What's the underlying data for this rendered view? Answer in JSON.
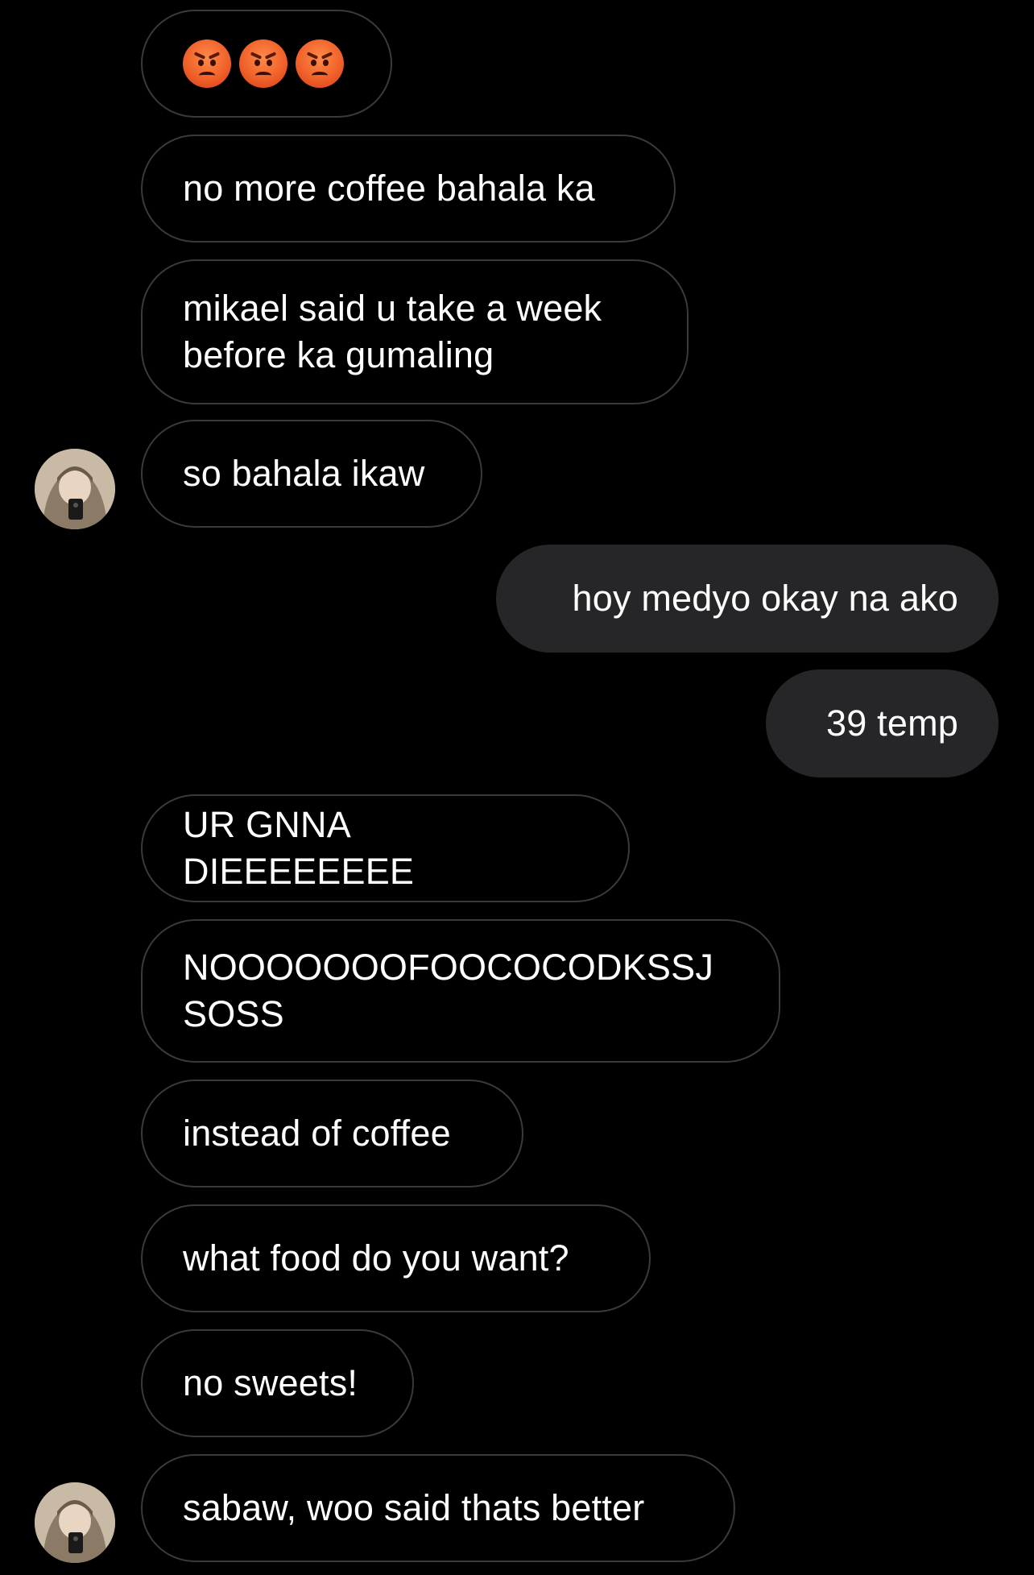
{
  "messages": [
    {
      "id": "m1",
      "direction": "incoming",
      "emoji": [
        "angry-face",
        "angry-face",
        "angry-face"
      ]
    },
    {
      "id": "m2",
      "direction": "incoming",
      "text": "no more coffee bahala ka"
    },
    {
      "id": "m3",
      "direction": "incoming",
      "text": "mikael said u take a week\nbefore ka gumaling"
    },
    {
      "id": "m4",
      "direction": "incoming",
      "text": "so bahala ikaw"
    },
    {
      "id": "m5",
      "direction": "outgoing",
      "text": "hoy medyo okay na ako"
    },
    {
      "id": "m6",
      "direction": "outgoing",
      "text": "39 temp"
    },
    {
      "id": "m7",
      "direction": "incoming",
      "text": "UR GNNA DIEEEEEEEE"
    },
    {
      "id": "m8",
      "direction": "incoming",
      "text": "NOOOOOOOFOOCOCODKSSJ\nSOSS"
    },
    {
      "id": "m9",
      "direction": "incoming",
      "text": "instead of coffee"
    },
    {
      "id": "m10",
      "direction": "incoming",
      "text": "what food do you want?"
    },
    {
      "id": "m11",
      "direction": "incoming",
      "text": "no sweets!"
    },
    {
      "id": "m12",
      "direction": "incoming",
      "text": "sabaw, woo said thats better"
    }
  ],
  "colors": {
    "background": "#000000",
    "incoming_border": "#3a3a3c",
    "outgoing_fill": "#262628",
    "text": "#ffffff"
  }
}
